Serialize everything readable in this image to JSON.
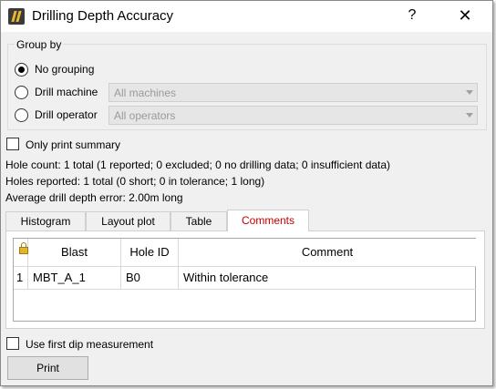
{
  "window": {
    "title": "Drilling Depth Accuracy",
    "help_glyph": "?",
    "close_glyph": "✕"
  },
  "group_by": {
    "label": "Group by",
    "options": [
      {
        "label": "No grouping",
        "checked": true
      },
      {
        "label": "Drill machine",
        "checked": false,
        "combo_value": "All machines"
      },
      {
        "label": "Drill operator",
        "checked": false,
        "combo_value": "All operators"
      }
    ]
  },
  "summary_checkbox": {
    "label": "Only print summary",
    "checked": false
  },
  "info": {
    "hole_count": "Hole count: 1 total (1 reported; 0 excluded; 0 no drilling data; 0 insufficient data)",
    "holes_reported": "Holes reported: 1 total (0 short; 0 in tolerance; 1 long)",
    "avg_error": "Average drill depth error: 2.00m long"
  },
  "tabs": [
    "Histogram",
    "Layout plot",
    "Table",
    "Comments"
  ],
  "active_tab": "Comments",
  "table": {
    "headers": [
      "Blast",
      "Hole ID",
      "Comment"
    ],
    "rows": [
      {
        "index": "1",
        "blast": "MBT_A_1",
        "hole_id": "B0",
        "comment": "Within tolerance"
      }
    ]
  },
  "dip_checkbox": {
    "label": "Use first dip measurement",
    "checked": false
  },
  "print_button": "Print",
  "colors": {
    "active_tab_text": "#c00000",
    "window_bg": "#f0f0f0"
  }
}
